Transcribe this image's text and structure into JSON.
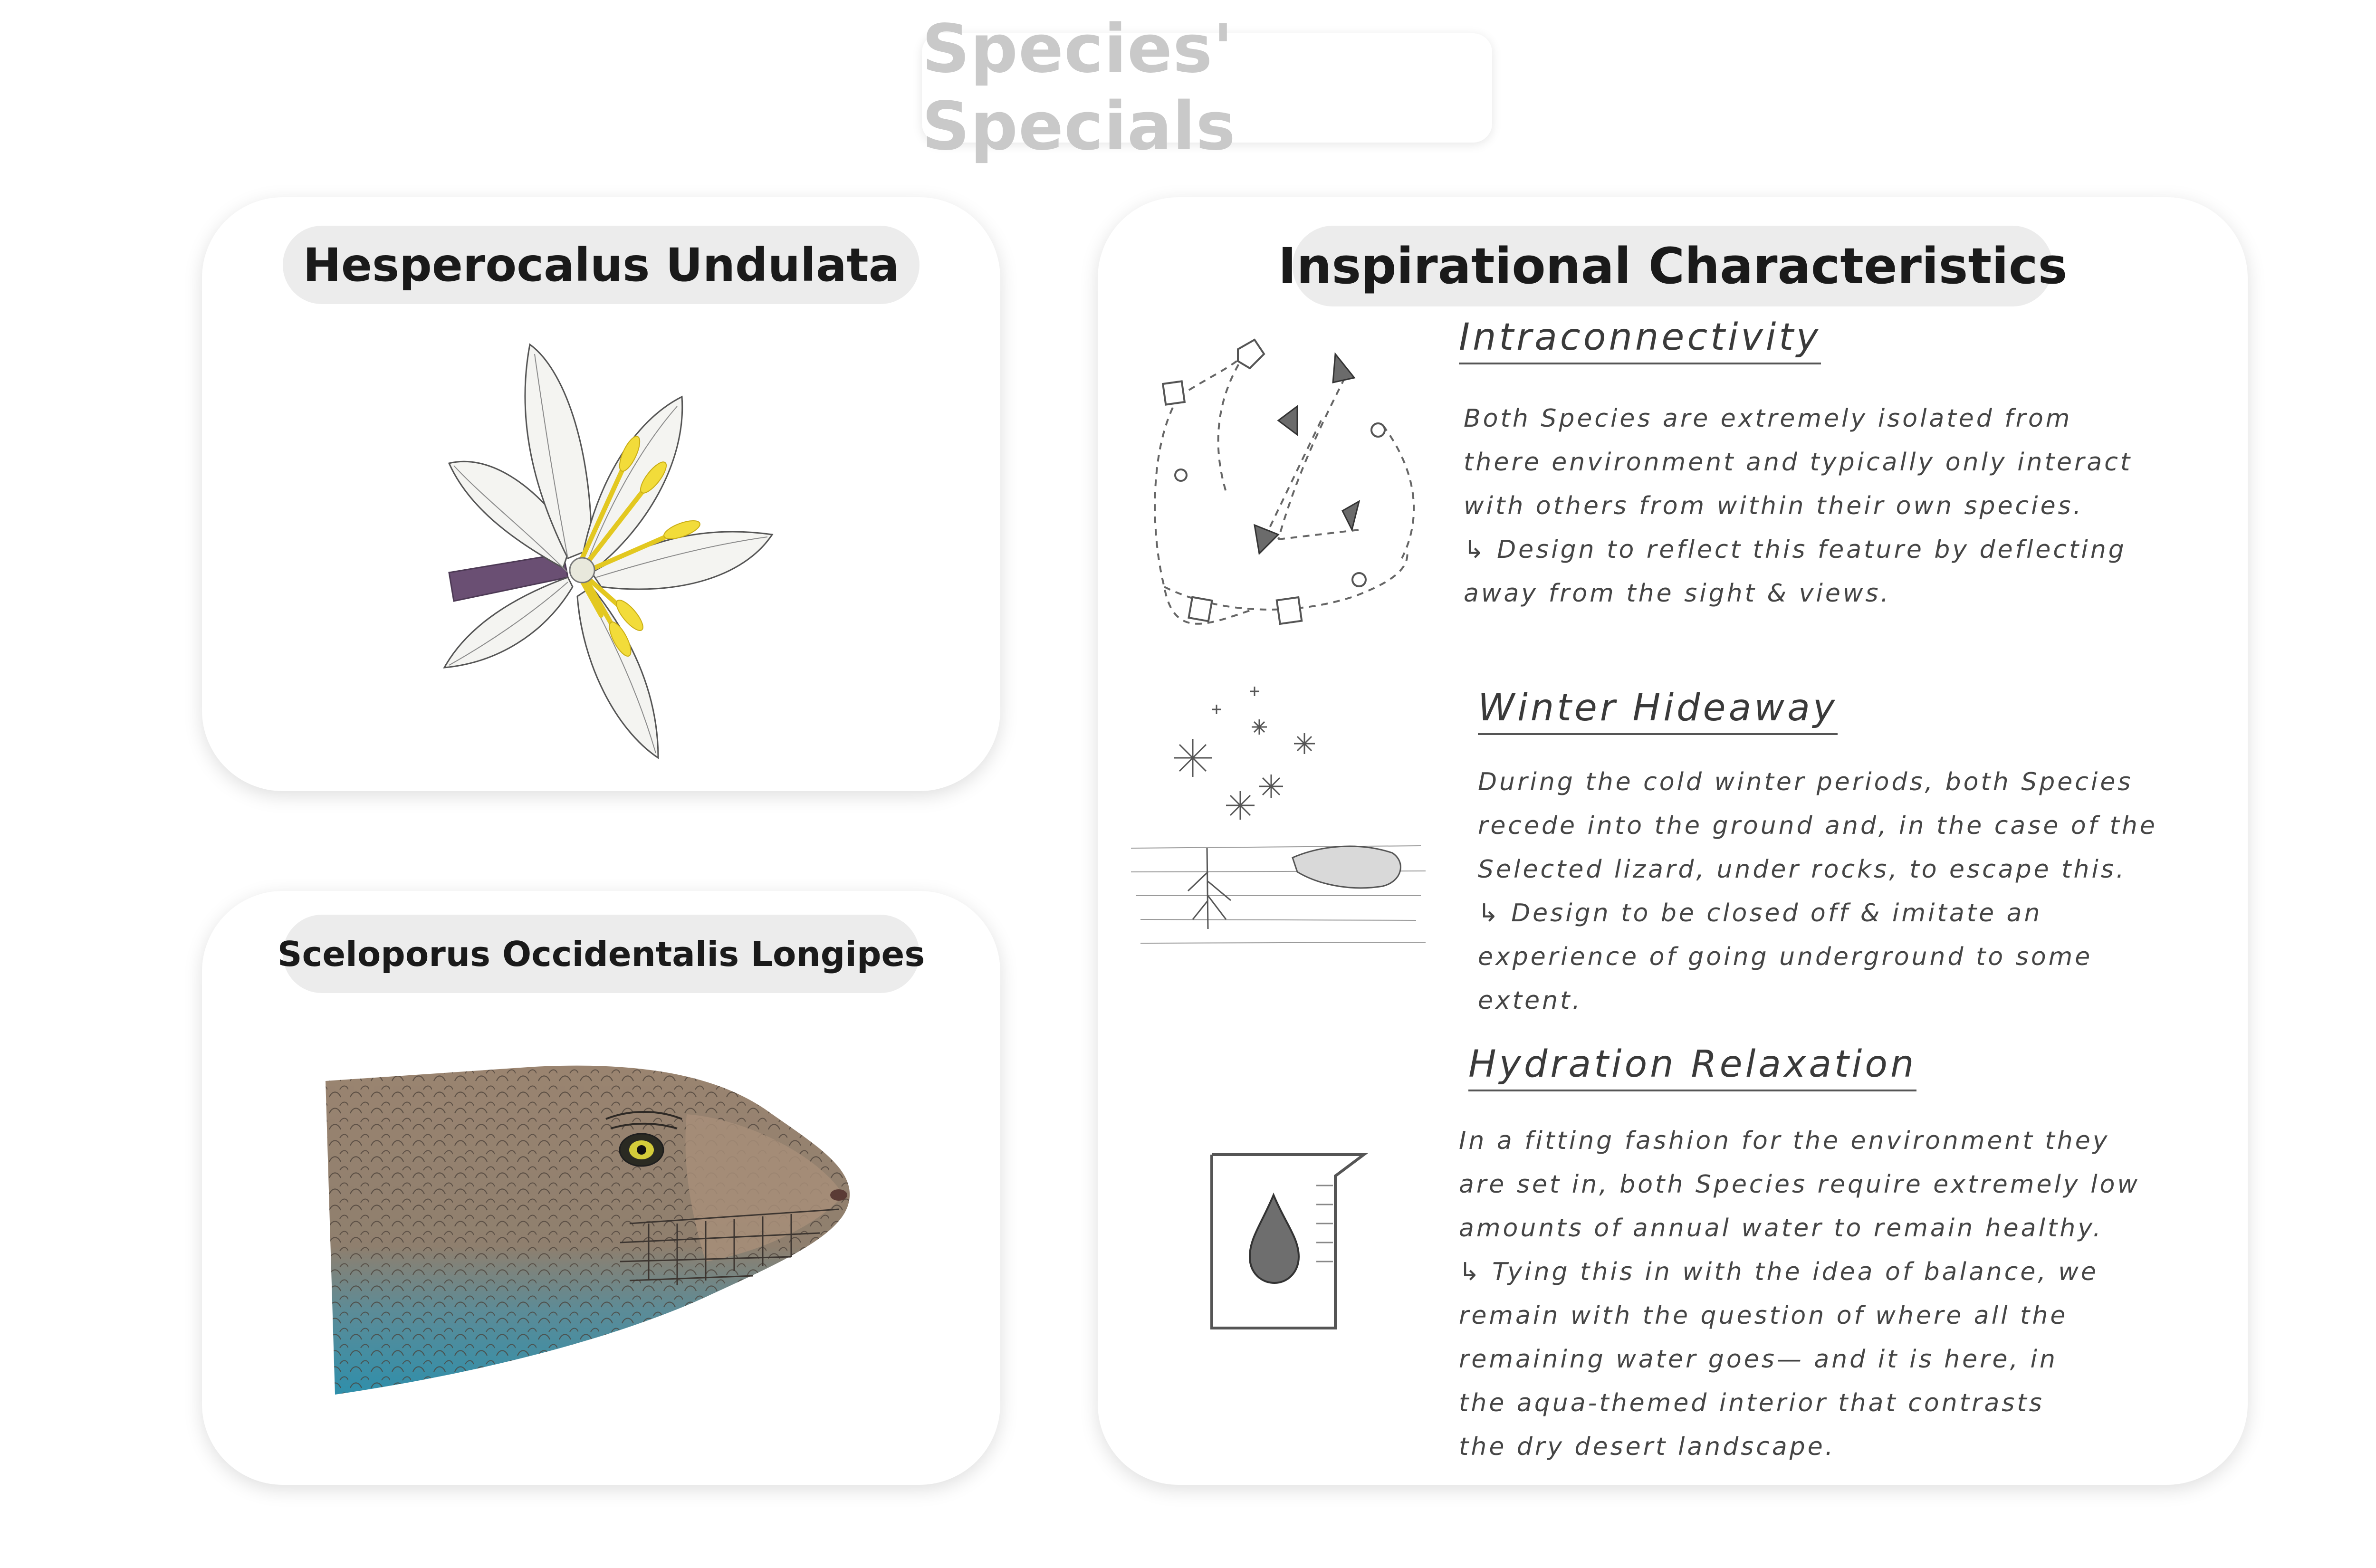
{
  "page_title": "Species' Specials",
  "species": {
    "lily": {
      "title": "Hesperocalus Undulata"
    },
    "lizard": {
      "title": "Sceloporus Occidentalis Longipes"
    }
  },
  "inspiration": {
    "title": "Inspirational Characteristics",
    "items": [
      {
        "heading": "Intraconnectivity",
        "body": "Both Species are extremely isolated from\nthere environment and typically only interact\nwith others from within their own species.\n↳ Design to reflect this feature by deflecting\n   away from the sight & views."
      },
      {
        "heading": "Winter Hideaway",
        "body": "During the cold winter periods, both Species\nrecede into the ground and, in the case of the\nSelected lizard, under rocks, to escape this.\n↳ Design to be closed off & imitate an\n   experience of going underground to some\n   extent."
      },
      {
        "heading": "Hydration Relaxation",
        "body": "In a fitting fashion for the environment they\nare set in, both Species require extremely low\namounts of annual water to remain healthy.\n↳ Tying this in with the idea of balance, we\n   remain with the question of where all the\n   remaining water goes— and it is here, in\n   the aqua-themed interior that contrasts\n   the dry desert landscape."
      }
    ]
  },
  "colors": {
    "title_text": "#c9c9c9",
    "pill_bg": "#ececec",
    "stamen": "#f2dc3a",
    "stem": "#6a4f73",
    "lizard_brown": "#8a7563",
    "lizard_blue": "#3f8fa6"
  },
  "icons": [
    "lily-flower-drawing",
    "lizard-head-drawing",
    "dashed-network-sketch",
    "snowflakes-underground-sketch",
    "water-glass-drop-sketch"
  ]
}
